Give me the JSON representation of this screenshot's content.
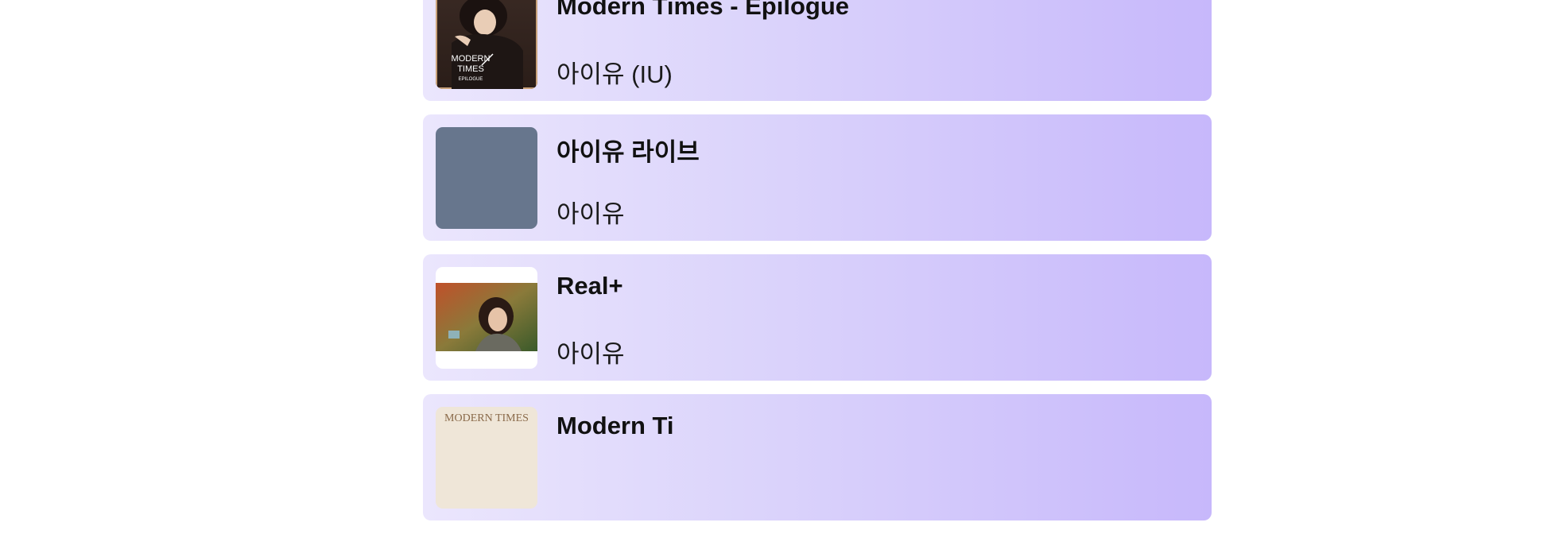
{
  "albums": [
    {
      "title": "Modern Times - Epilogue",
      "artist": "아이유 (IU)",
      "cover_icon": "album-cover-modern-times-epilogue",
      "cover_text": [
        "MODERN",
        "TIMES",
        "EPILOGUE"
      ]
    },
    {
      "title": "아이유 라이브",
      "artist": "아이유",
      "cover_icon": "album-cover-placeholder",
      "placeholder_color": "#67768d"
    },
    {
      "title": "Real+",
      "artist": "아이유",
      "cover_icon": "album-cover-real-plus"
    },
    {
      "title": "Modern Ti",
      "artist": "",
      "cover_icon": "album-cover-modern-times",
      "cover_text": [
        "MODERN TIMES"
      ]
    }
  ],
  "colors": {
    "card_gradient_start": "#ebe6fd",
    "card_gradient_end": "#c7b8fb",
    "placeholder": "#67768d"
  }
}
